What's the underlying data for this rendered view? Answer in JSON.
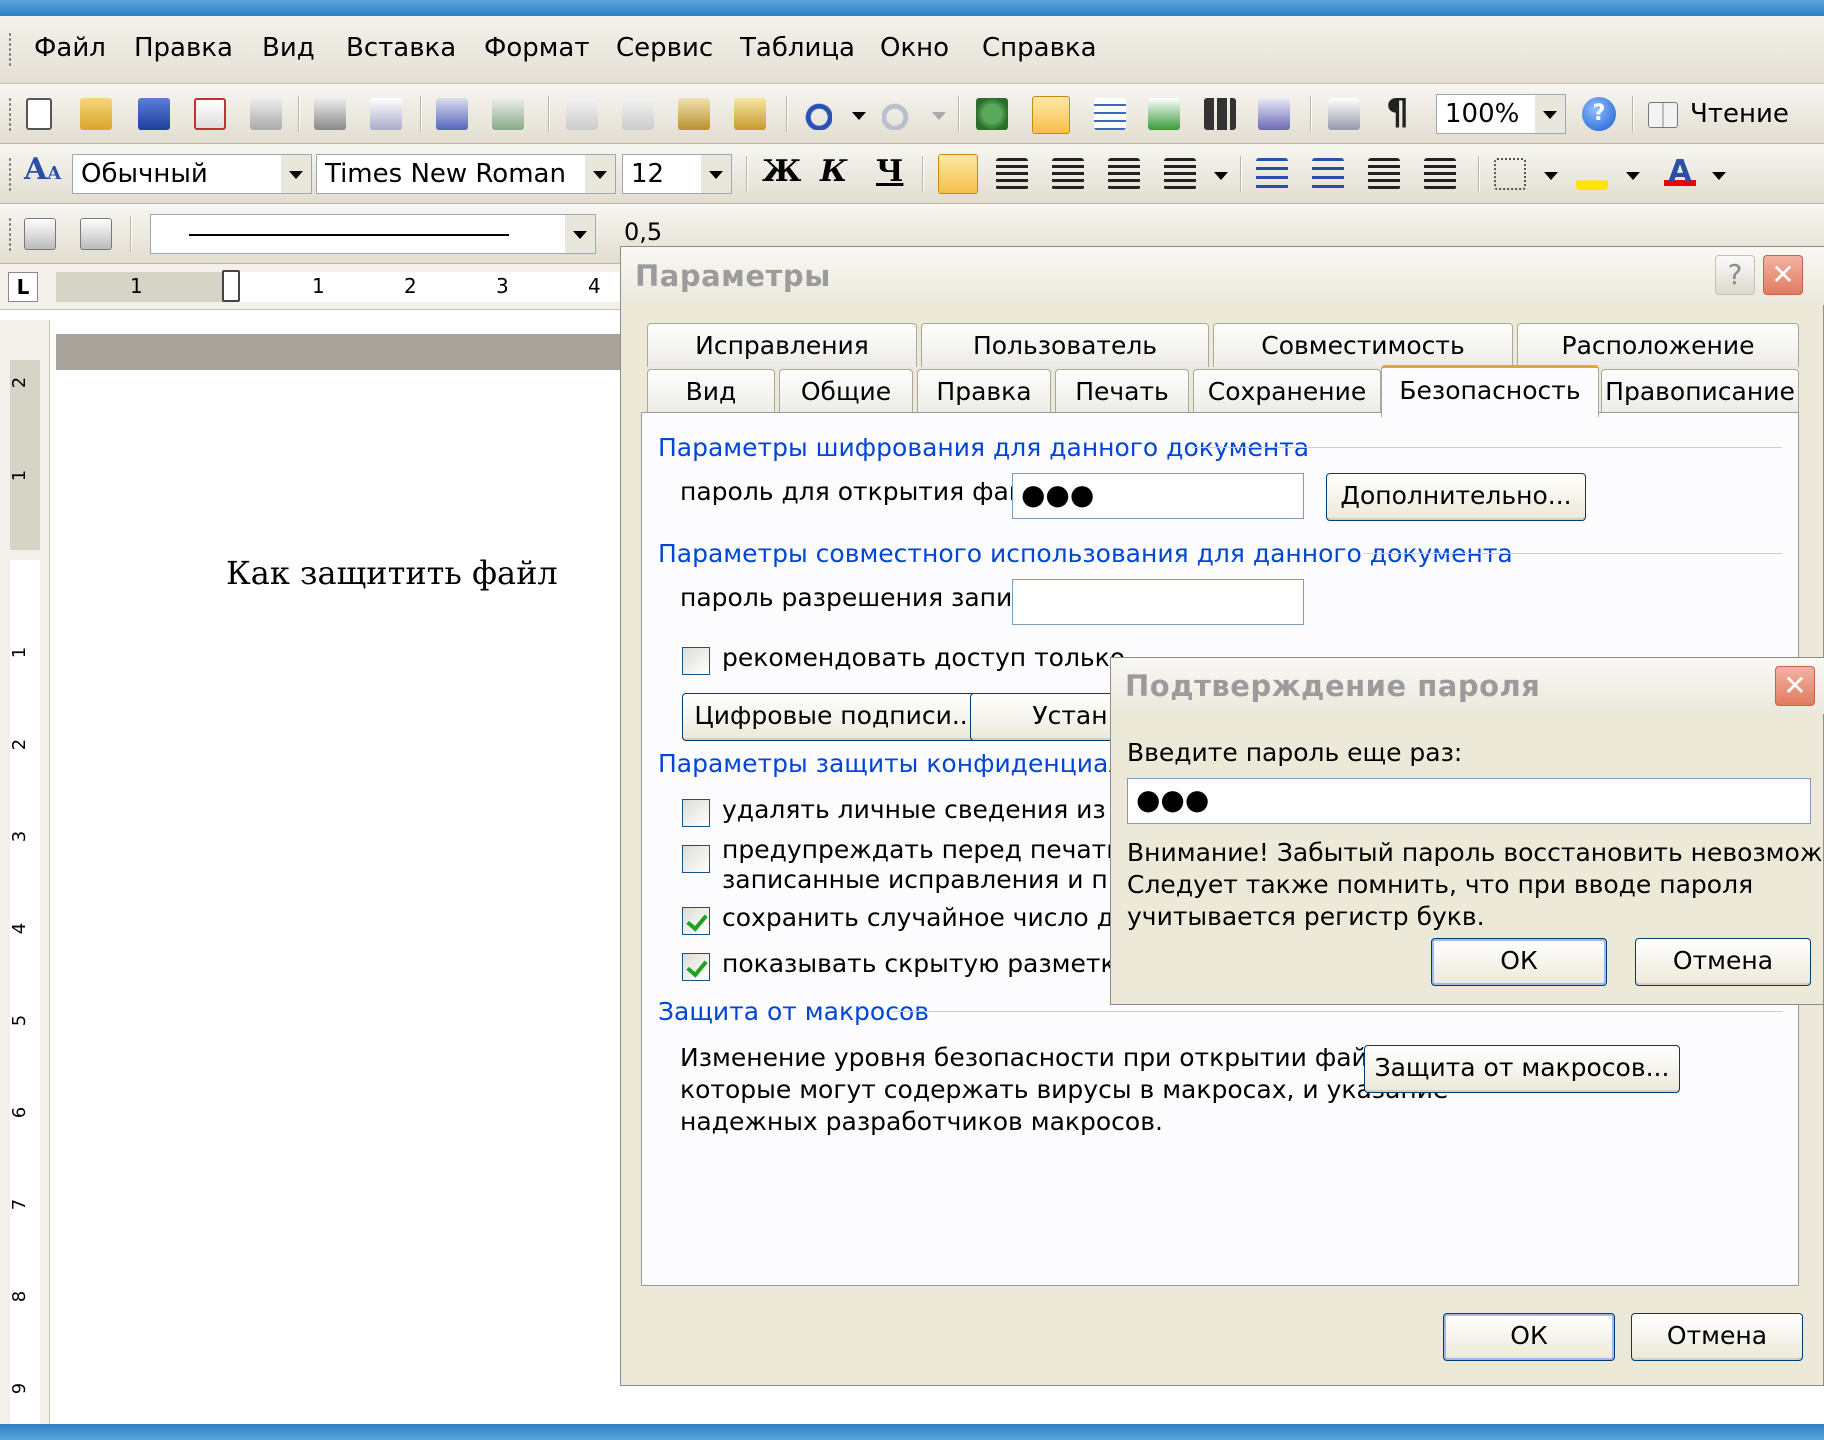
{
  "menu": {
    "items": [
      "Файл",
      "Правка",
      "Вид",
      "Вставка",
      "Формат",
      "Сервис",
      "Таблица",
      "Окно",
      "Справка"
    ]
  },
  "toolbar_standard": {
    "zoom": "100%",
    "reading_label": "Чтение",
    "icons": [
      "new-icon",
      "open-icon",
      "save-icon",
      "permission-icon",
      "email-icon",
      "print-icon",
      "print-preview-icon",
      "spelling-icon",
      "research-icon",
      "cut-icon",
      "copy-icon",
      "paste-icon",
      "format-painter-icon",
      "undo-icon",
      "redo-icon",
      "hyperlink-icon",
      "tables-borders-icon",
      "insert-table-icon",
      "insert-excel-icon",
      "columns-icon",
      "drawing-icon",
      "document-map-icon",
      "show-formatting-icon",
      "help-icon",
      "reading-icon"
    ]
  },
  "toolbar_formatting": {
    "style": "Обычный",
    "font": "Times New Roman",
    "size": "12",
    "bold": "Ж",
    "italic": "К",
    "underline": "Ч"
  },
  "toolbar_drawing": {
    "line_width": "0,5"
  },
  "document": {
    "text": "Как защитить файл",
    "ruler_marks": [
      "1",
      "1",
      "2",
      "3",
      "4"
    ],
    "vruler_marks": [
      "2",
      "1",
      "1",
      "2",
      "3",
      "4",
      "5",
      "6",
      "7",
      "8",
      "9"
    ]
  },
  "options_dialog": {
    "title": "Параметры",
    "help_glyph": "?",
    "close_glyph": "✕",
    "tabs_row1": [
      "Исправления",
      "Пользователь",
      "Совместимость",
      "Расположение"
    ],
    "tabs_row2": [
      "Вид",
      "Общие",
      "Правка",
      "Печать",
      "Сохранение",
      "Безопасность",
      "Правописание"
    ],
    "active_tab": "Безопасность",
    "encryption": {
      "group": "Параметры шифрования для данного документа",
      "label": "пароль для открытия файла:",
      "value": "●●●",
      "button": "Дополнительно..."
    },
    "sharing": {
      "group": "Параметры совместного использования для данного документа",
      "label": "пароль разрешения записи:",
      "value": "",
      "readonly_label": "рекомендовать доступ только",
      "digital_button": "Цифровые подписи...",
      "protect_button": "Устан"
    },
    "privacy": {
      "group": "Параметры защиты конфиденциальн",
      "items": [
        {
          "label": "удалять личные сведения из св",
          "checked": false
        },
        {
          "label": "предупреждать перед печатью",
          "label2": "записанные исправления и при",
          "checked": false
        },
        {
          "label": "сохранить случайное число для",
          "checked": true
        },
        {
          "label": "показывать скрытую разметку при открытии и сохранении",
          "checked": true
        }
      ]
    },
    "macro": {
      "group": "Защита от макросов",
      "description": [
        "Изменение уровня безопасности при открытии файлов,",
        "которые могут содержать вирусы в макросах, и указание",
        "надежных разработчиков макросов."
      ],
      "button": "Защита от макросов..."
    },
    "ok": "ОК",
    "cancel": "Отмена"
  },
  "confirm_dialog": {
    "title": "Подтверждение пароля",
    "close_glyph": "✕",
    "prompt": "Введите пароль еще раз:",
    "value": "●●●",
    "warning": [
      "Внимание! Забытый пароль восстановить невозможно.",
      "Следует также помнить, что при вводе пароля",
      "учитывается регистр букв."
    ],
    "ok": "ОК",
    "cancel": "Отмена"
  },
  "colors": {
    "group_blue": "#0046d5",
    "tab_active_orange": "#f0a02f",
    "dialog_bg": "#ece9d8",
    "close_red": "#e27b62"
  }
}
